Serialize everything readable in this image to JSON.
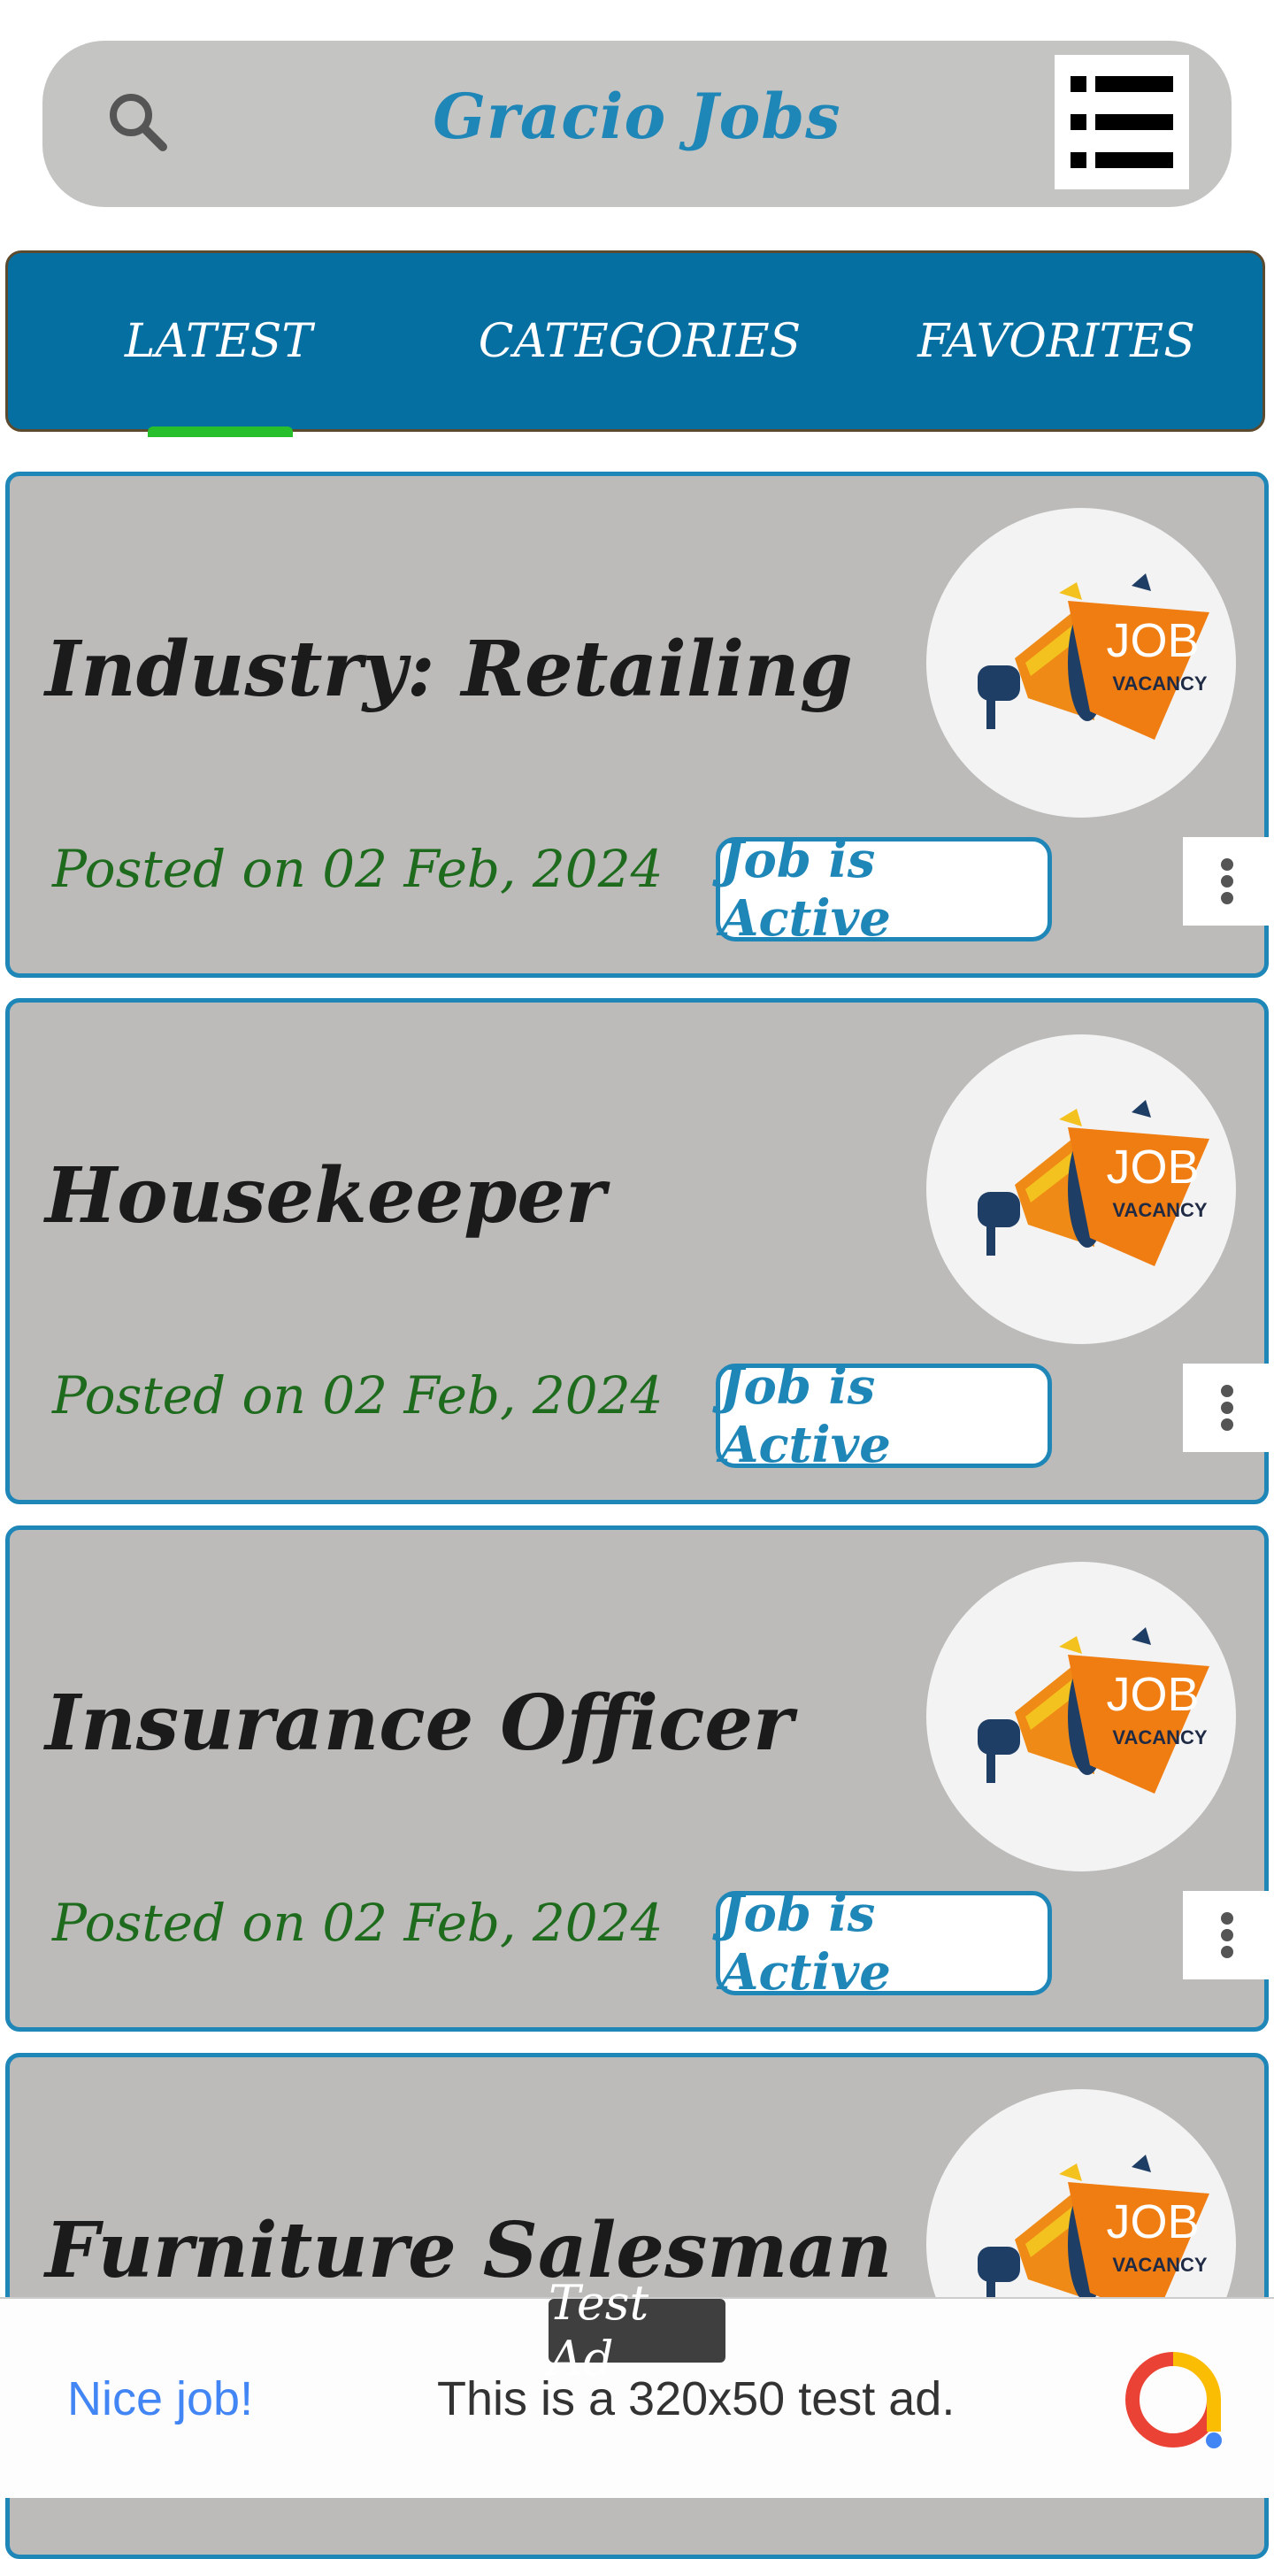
{
  "header": {
    "title": "Gracio Jobs",
    "search_icon": "search-icon",
    "menu_icon": "list-menu-icon"
  },
  "tabs": [
    {
      "label": "LATEST",
      "selected": true
    },
    {
      "label": "CATEGORIES",
      "selected": false
    },
    {
      "label": "FAVORITES",
      "selected": false
    }
  ],
  "jobs": [
    {
      "title": "Industry: Retailing",
      "posted": "Posted on 02 Feb, 2024",
      "status": "Job is Active",
      "thumb_text": "JOB",
      "thumb_sub": "VACANCY"
    },
    {
      "title": "Housekeeper",
      "posted": "Posted on 02 Feb, 2024",
      "status": "Job is Active",
      "thumb_text": "JOB",
      "thumb_sub": "VACANCY"
    },
    {
      "title": "Insurance Officer",
      "posted": "Posted on 02 Feb, 2024",
      "status": "Job is Active",
      "thumb_text": "JOB",
      "thumb_sub": "VACANCY"
    },
    {
      "title": "Furniture Salesman",
      "thumb_text": "JOB",
      "thumb_sub": "VACANCY"
    }
  ],
  "ad": {
    "label": "Test Ad",
    "headline": "Nice job!",
    "text": "This is a 320x50 test ad."
  },
  "colors": {
    "accent": "#1f86b8",
    "tab_bar": "#066fa1",
    "indicator": "#27c02c",
    "date_text": "#1e6b1e",
    "card_bg": "#bcbbba"
  }
}
